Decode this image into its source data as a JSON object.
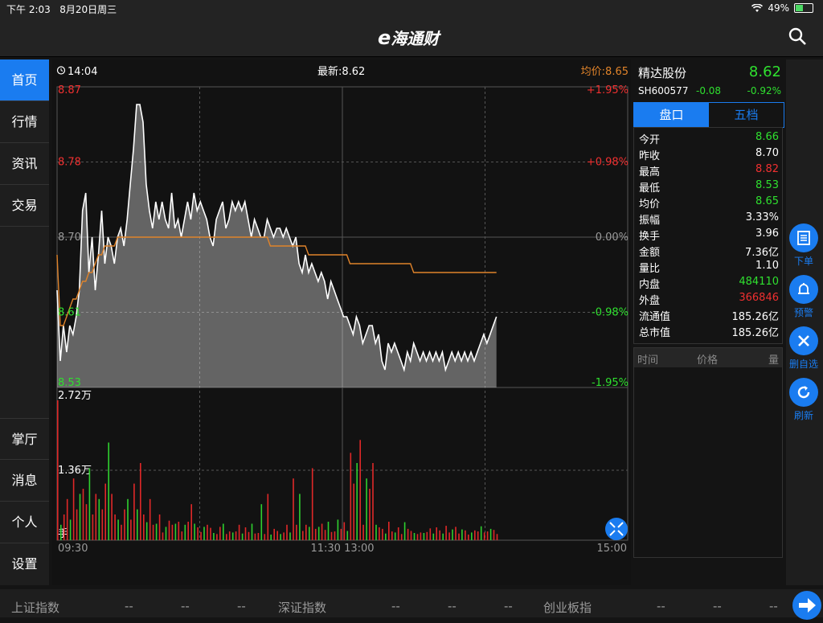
{
  "status": {
    "time": "下午 2:03",
    "date": "8月20日周三",
    "battery": "49%"
  },
  "app": {
    "logo_e": "e",
    "logo_text": "海通财"
  },
  "sidebar": {
    "top": [
      {
        "label": "首页"
      },
      {
        "label": "行情"
      },
      {
        "label": "资讯"
      },
      {
        "label": "交易"
      }
    ],
    "bottom": [
      {
        "label": "掌厅"
      },
      {
        "label": "消息"
      },
      {
        "label": "个人"
      },
      {
        "label": "设置"
      }
    ]
  },
  "chart_header": {
    "time": "14:04",
    "latest": "最新:8.62",
    "avg": "均价:8.65"
  },
  "chart_data": {
    "type": "line",
    "x_ticks": [
      "09:30",
      "11:30 13:00",
      "15:00"
    ],
    "y_left_ticks": [
      "8.87",
      "8.78",
      "8.70",
      "8.61",
      "8.53"
    ],
    "y_right_ticks": [
      "+1.95%",
      "+0.98%",
      "0.00%",
      "-0.98%",
      "-1.95%"
    ],
    "ylim": [
      8.53,
      8.87
    ],
    "volume_ticks": [
      "2.72万",
      "1.36万",
      "手"
    ],
    "volume_max": 27200,
    "series": [
      {
        "values": [
          8.64,
          8.56,
          8.6,
          8.57,
          8.6,
          8.59,
          8.61,
          8.64,
          8.73,
          8.75,
          8.66,
          8.7,
          8.64,
          8.68,
          8.73,
          8.67,
          8.7,
          8.69,
          8.67,
          8.7,
          8.71,
          8.69,
          8.72,
          8.76,
          8.8,
          8.85,
          8.85,
          8.83,
          8.76,
          8.73,
          8.71,
          8.74,
          8.72,
          8.74,
          8.72,
          8.71,
          8.75,
          8.71,
          8.72,
          8.7,
          8.72,
          8.74,
          8.72,
          8.75,
          8.73,
          8.74,
          8.73,
          8.72,
          8.7,
          8.69,
          8.72,
          8.73,
          8.74,
          8.71,
          8.72,
          8.74,
          8.73,
          8.74,
          8.73,
          8.74,
          8.72,
          8.7,
          8.72,
          8.71,
          8.7,
          8.7,
          8.72,
          8.71,
          8.7,
          8.71,
          8.71,
          8.7,
          8.71,
          8.7,
          8.69,
          8.7,
          8.67,
          8.66,
          8.68,
          8.66,
          8.67,
          8.66,
          8.65,
          8.66,
          8.65,
          8.63,
          8.65,
          8.64,
          8.63,
          8.62,
          8.61,
          8.61,
          8.6,
          8.59,
          8.61,
          8.6,
          8.58,
          8.59,
          8.6,
          8.6,
          8.58,
          8.59,
          8.56,
          8.55,
          8.58,
          8.57,
          8.58,
          8.57,
          8.56,
          8.55,
          8.57,
          8.56,
          8.58,
          8.57,
          8.56,
          8.57,
          8.56,
          8.57,
          8.56,
          8.57,
          8.56,
          8.57,
          8.55,
          8.56,
          8.57,
          8.56,
          8.57,
          8.56,
          8.57,
          8.56,
          8.57,
          8.56,
          8.57,
          8.58,
          8.59,
          8.58,
          8.59,
          8.6,
          8.61
        ]
      },
      {
        "values": [
          8.68,
          8.6,
          8.6,
          8.61,
          8.62,
          8.63,
          8.63,
          8.64,
          8.65,
          8.65,
          8.66,
          8.66,
          8.67,
          8.68,
          8.68,
          8.69,
          8.69,
          8.69,
          8.69,
          8.7,
          8.7,
          8.7,
          8.7,
          8.7,
          8.7,
          8.7,
          8.7,
          8.7,
          8.7,
          8.7,
          8.7,
          8.7,
          8.7,
          8.7,
          8.7,
          8.7,
          8.7,
          8.7,
          8.7,
          8.7,
          8.7,
          8.7,
          8.7,
          8.7,
          8.7,
          8.7,
          8.7,
          8.7,
          8.7,
          8.7,
          8.7,
          8.7,
          8.7,
          8.7,
          8.7,
          8.7,
          8.7,
          8.7,
          8.7,
          8.7,
          8.7,
          8.7,
          8.7,
          8.7,
          8.7,
          8.7,
          8.7,
          8.69,
          8.69,
          8.69,
          8.69,
          8.69,
          8.69,
          8.69,
          8.69,
          8.69,
          8.69,
          8.69,
          8.69,
          8.68,
          8.68,
          8.68,
          8.68,
          8.68,
          8.68,
          8.68,
          8.68,
          8.68,
          8.68,
          8.68,
          8.68,
          8.68,
          8.67,
          8.67,
          8.67,
          8.67,
          8.67,
          8.67,
          8.67,
          8.67,
          8.67,
          8.67,
          8.67,
          8.67,
          8.67,
          8.67,
          8.67,
          8.67,
          8.67,
          8.67,
          8.67,
          8.67,
          8.66,
          8.66,
          8.66,
          8.66,
          8.66,
          8.66,
          8.66,
          8.66,
          8.66,
          8.66,
          8.66,
          8.66,
          8.66,
          8.66,
          8.66,
          8.66,
          8.66,
          8.66,
          8.66,
          8.66,
          8.66,
          8.66,
          8.66,
          8.66,
          8.66,
          8.66,
          8.66
        ]
      }
    ],
    "volume": [
      27200,
      3000,
      5000,
      8000,
      4000,
      12000,
      6000,
      9000,
      10000,
      7000,
      14000,
      5000,
      9000,
      8000,
      6000,
      11000,
      19000,
      9000,
      5000,
      4000,
      3000,
      6000,
      8000,
      4000,
      11000,
      6000,
      15000,
      5000,
      3500,
      8000,
      3000,
      3200,
      5000,
      1500,
      2600,
      3800,
      3000,
      3200,
      3600,
      1700,
      3000,
      3600,
      7000,
      3200,
      2500,
      1600,
      2600,
      3000,
      2400,
      1400,
      1200,
      2600,
      3200,
      1200,
      1700,
      1500,
      1700,
      3000,
      1300,
      2500,
      1600,
      3200,
      1300,
      1400,
      7000,
      1200,
      9000,
      1100,
      2200,
      1800,
      1200,
      1500,
      3000,
      1500,
      12000,
      3000,
      9000,
      1800,
      3000,
      2600,
      14000,
      2200,
      2600,
      3200,
      2000,
      3600,
      1600,
      1700,
      4000,
      2200,
      3500,
      1800,
      17000,
      11000,
      15000,
      19500,
      3000,
      12000,
      10000,
      15000,
      3000,
      2500,
      2200,
      1300,
      3600,
      1700,
      1500,
      2500,
      1200,
      3500,
      2200,
      1800,
      1400,
      1200,
      1500,
      1400,
      1600,
      2300,
      1300,
      2500,
      1900,
      1300,
      2800,
      1500,
      2100,
      2600,
      1300,
      2100,
      1900,
      1100,
      1500,
      1900,
      1700,
      2700,
      1500,
      1700,
      2200,
      2000,
      1200
    ]
  },
  "quote": {
    "name": "精达股份",
    "price": "8.62",
    "code": "SH600577",
    "change": "-0.08",
    "pct": "-0.92%",
    "tabs": [
      "盘口",
      "五档"
    ],
    "stats": [
      {
        "k": "今开",
        "v": "8.66",
        "color": "#2fe02f"
      },
      {
        "k": "昨收",
        "v": "8.70",
        "color": "#ffffff"
      },
      {
        "k": "最高",
        "v": "8.82",
        "color": "#f03030"
      },
      {
        "k": "最低",
        "v": "8.53",
        "color": "#2fe02f"
      },
      {
        "k": "均价",
        "v": "8.65",
        "color": "#2fe02f"
      },
      {
        "k": "振幅",
        "v": "3.33%",
        "color": "#ffffff"
      },
      {
        "k": "换手",
        "v": "3.96",
        "color": "#ffffff"
      },
      {
        "k": "金额",
        "v": "7.36亿",
        "color": "#ffffff"
      },
      {
        "k": "量比",
        "v": "1.10",
        "color": "#ffffff"
      },
      {
        "k": "内盘",
        "v": "484110",
        "color": "#2fe02f"
      },
      {
        "k": "外盘",
        "v": "366846",
        "color": "#f03030"
      },
      {
        "k": "流通值",
        "v": "185.26亿",
        "color": "#ffffff"
      },
      {
        "k": "总市值",
        "v": "185.26亿",
        "color": "#ffffff"
      }
    ],
    "trade_headers": [
      "时间",
      "价格",
      "量"
    ]
  },
  "tools": [
    {
      "label": "下单"
    },
    {
      "label": "预警"
    },
    {
      "label": "删自选"
    },
    {
      "label": "刷新"
    }
  ],
  "bottom_bar": {
    "items": [
      {
        "name": "上证指数",
        "v1": "--",
        "v2": "--",
        "v3": "--"
      },
      {
        "name": "深证指数",
        "v1": "--",
        "v2": "--",
        "v3": "--"
      },
      {
        "name": "创业板指",
        "v1": "--",
        "v2": "--",
        "v3": "--"
      }
    ]
  },
  "colors": {
    "accent": "#1a7cf0",
    "up": "#f03030",
    "down": "#2fe02f",
    "avg": "#e0832a"
  }
}
